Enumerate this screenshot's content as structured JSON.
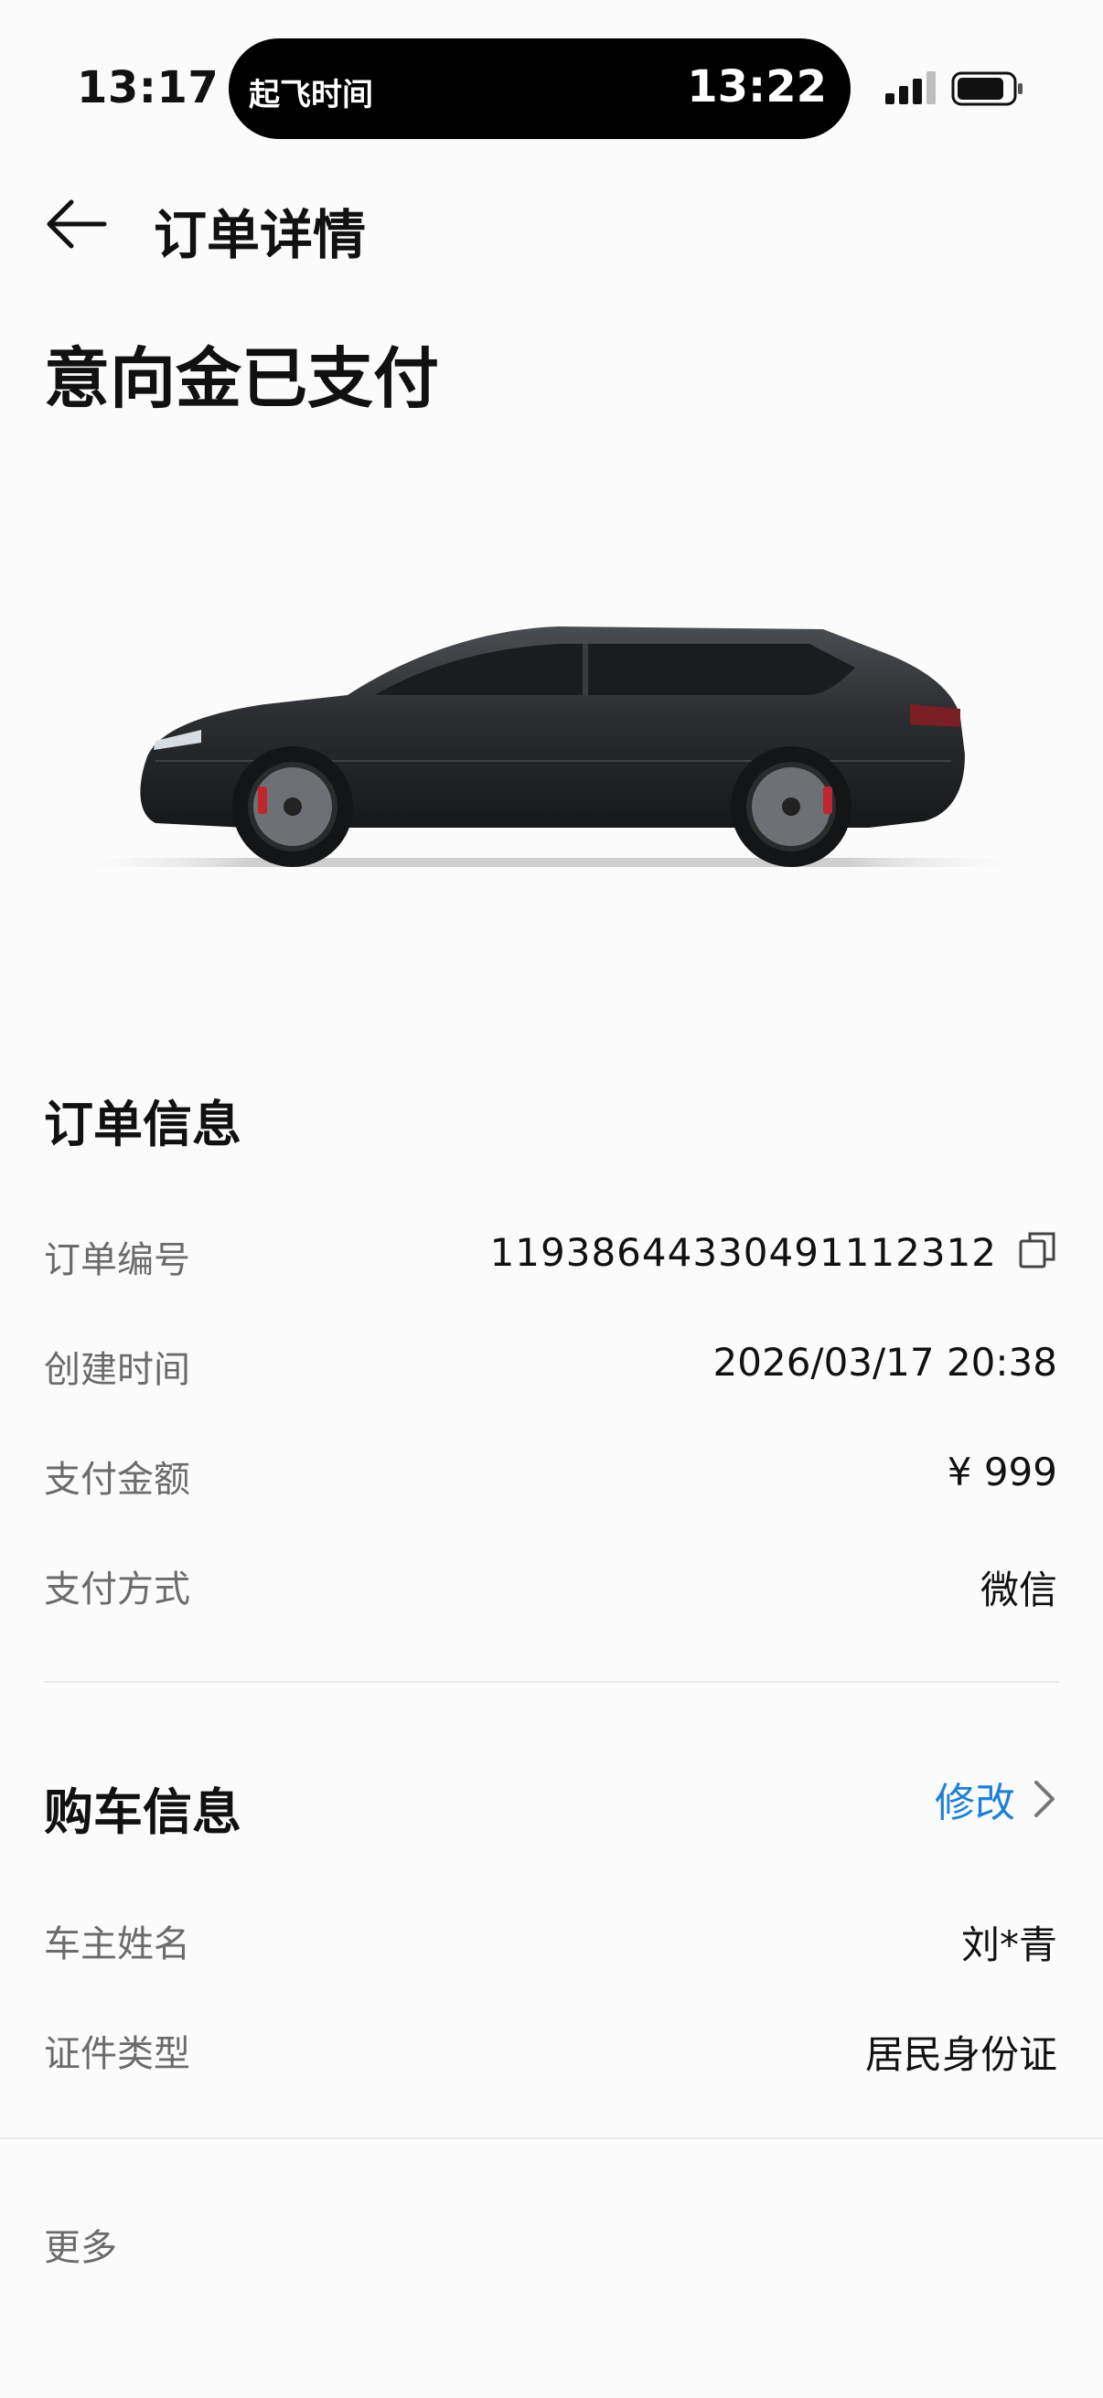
{
  "status_bar": {
    "time": "13:17",
    "island_title": "起飞时间",
    "island_time": "13:22",
    "signal_icon": "signal-icon",
    "battery_icon": "battery-icon"
  },
  "header": {
    "title": "订单详情",
    "back_icon": "back-arrow-icon"
  },
  "status_title": "意向金已支付",
  "car_image": {
    "colors": {
      "body": "#2b2d30",
      "window": "#1a1c1f",
      "caliper": "#c0262d"
    }
  },
  "order_info": {
    "title": "订单信息",
    "rows": [
      {
        "label": "订单编号",
        "value": "11938644330491112312",
        "icon": "copy-icon"
      },
      {
        "label": "创建时间",
        "value": "2026/03/17 20:38"
      },
      {
        "label": "支付金额",
        "value": "¥ 999"
      },
      {
        "label": "支付方式",
        "value": "微信"
      }
    ]
  },
  "purchase_info": {
    "title": "购车信息",
    "edit_label": "修改",
    "edit_color": "#1e80d6",
    "rows": [
      {
        "label": "车主姓名",
        "value": "刘*青"
      },
      {
        "label": "证件类型",
        "value": "居民身份证"
      }
    ]
  },
  "more_label": "更多"
}
